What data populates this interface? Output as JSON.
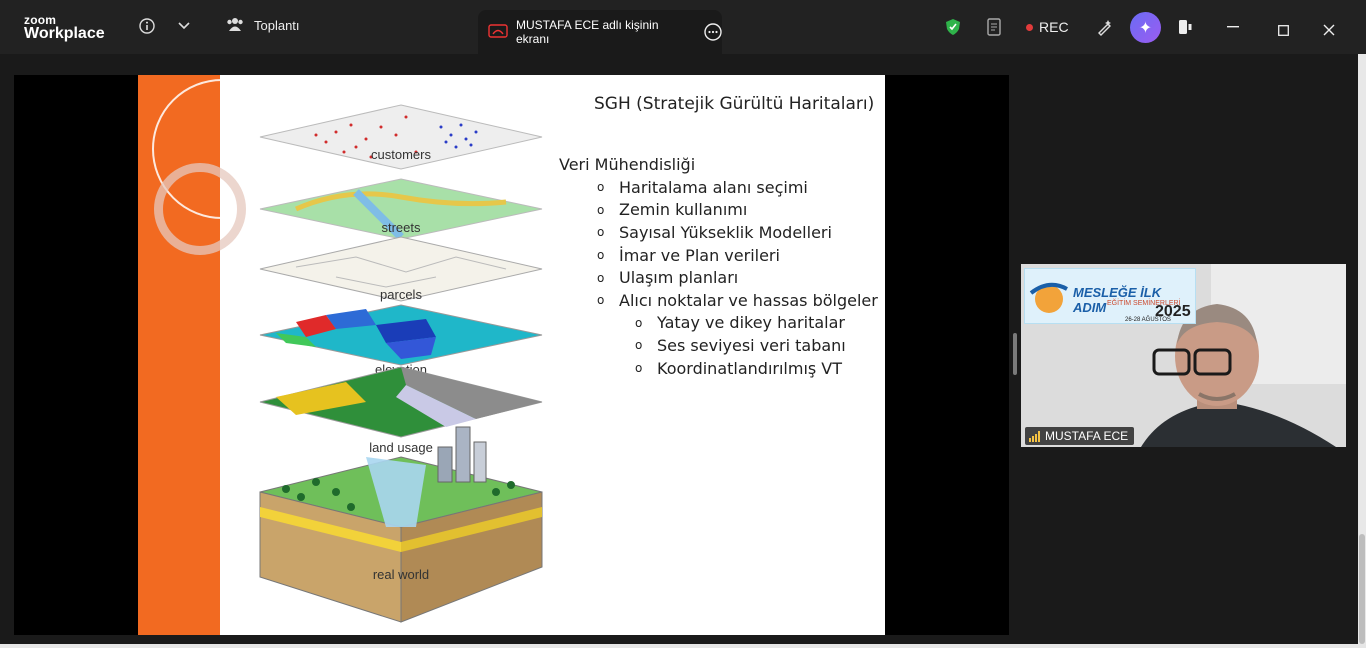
{
  "app": {
    "brand_top": "zoom",
    "brand_bottom": "Workplace"
  },
  "meeting": {
    "label": "Toplantı"
  },
  "share_tab": {
    "label": "MUSTAFA ECE adlı kişinin ekranı"
  },
  "recording": {
    "label": "REC"
  },
  "slide": {
    "title": "SGH (Stratejik Gürültü Haritaları)",
    "heading": "Veri Mühendisliği",
    "bullets": [
      "Haritalama alanı seçimi",
      "Zemin kullanımı",
      "Sayısal Yükseklik Modelleri",
      "İmar ve Plan verileri",
      "Ulaşım planları",
      "Alıcı noktalar ve hassas bölgeler"
    ],
    "sub_bullets": [
      "Yatay ve dikey haritalar",
      "Ses seviyesi veri tabanı",
      "Koordinatlandırılmış VT"
    ],
    "bullet_marker": "o",
    "layer_labels": [
      "customers",
      "streets",
      "parcels",
      "elevation",
      "land usage",
      "real world"
    ]
  },
  "video": {
    "participant": "MUSTAFA ECE",
    "banner_title": "MESLEĞE İLK ADIM",
    "banner_subtitle": "EĞİTİM SEMİNERLERİ",
    "banner_year": "2025",
    "banner_dates": "26-28 AĞUSTOS"
  },
  "colors": {
    "accent_orange": "#f26a21",
    "rec_red": "#e23b3b",
    "shield_green": "#2fb34a",
    "ai_purple": "#7b62f2"
  }
}
